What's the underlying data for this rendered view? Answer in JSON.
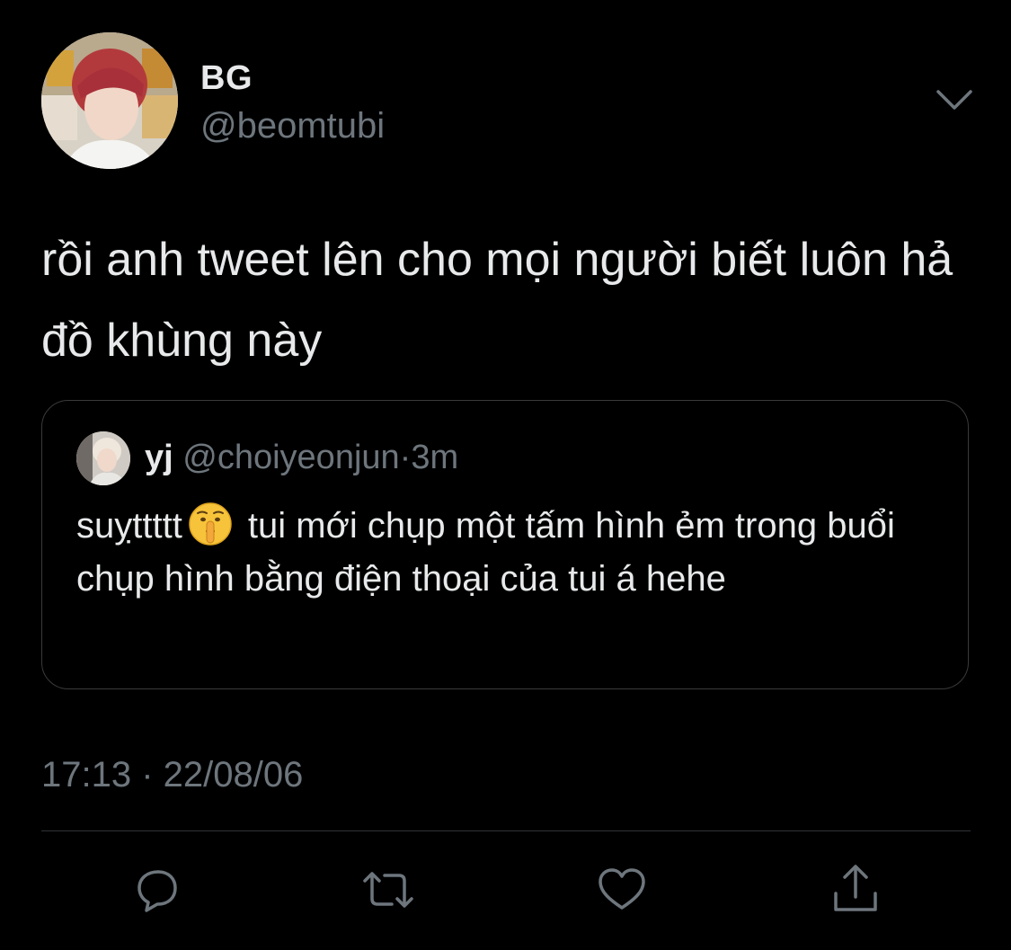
{
  "tweet": {
    "author_name": "BG",
    "author_handle": "@beomtubi",
    "text": "rồi anh tweet lên cho mọi người biết luôn hả đồ khùng này",
    "timestamp": "17:13 · 22/08/06"
  },
  "quote": {
    "name": "yj",
    "handle": "@choiyeonjun",
    "separator": "·",
    "time": "3m",
    "text_before_emoji": "suỵttttt",
    "emoji": "shushing-face-emoji",
    "text_after_emoji": "tui mới chụp một tấm hình ẻm trong buổi chụp hình bằng điện thoại của tui á hehe"
  },
  "icons": {
    "more": "chevron-down-icon",
    "reply": "reply-icon",
    "retweet": "retweet-icon",
    "like": "heart-icon",
    "share": "share-icon"
  },
  "colors": {
    "background": "#000000",
    "text_primary": "#e7e9ea",
    "text_secondary": "#6e767d",
    "border": "#3a3a3a"
  }
}
